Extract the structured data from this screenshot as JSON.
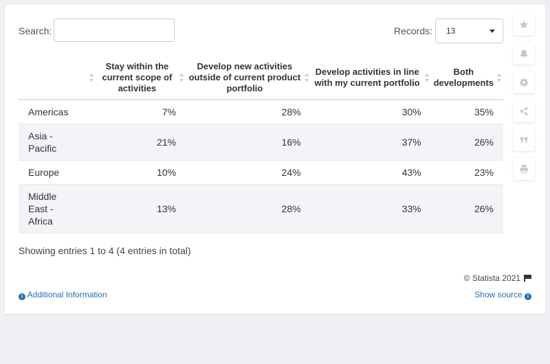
{
  "search": {
    "label": "Search:",
    "value": "",
    "placeholder": ""
  },
  "records": {
    "label": "Records:",
    "value": "13"
  },
  "table": {
    "columns": [
      "",
      "Stay within the current scope of activities",
      "Develop new activities outside of current product portfolio",
      "Develop activities in line with my current portfolio",
      "Both developments"
    ],
    "rows": [
      {
        "region": "Americas",
        "values": [
          "7%",
          "28%",
          "30%",
          "35%"
        ]
      },
      {
        "region": "Asia - Pacific",
        "values": [
          "21%",
          "16%",
          "37%",
          "26%"
        ]
      },
      {
        "region": "Europe",
        "values": [
          "10%",
          "24%",
          "43%",
          "23%"
        ]
      },
      {
        "region": "Middle East - Africa",
        "values": [
          "13%",
          "28%",
          "33%",
          "26%"
        ]
      }
    ]
  },
  "footer": {
    "showing": "Showing entries 1 to 4 (4 entries in total)",
    "copyright": "© Statista 2021",
    "additional_info": "Additional Information",
    "show_source": "Show source"
  },
  "toolbar": [
    "star-icon",
    "bell-icon",
    "gear-icon",
    "share-icon",
    "quote-icon",
    "print-icon"
  ],
  "colors": {
    "link": "#1f6fb5",
    "row_alt": "#f2f4f7",
    "icon": "#c4c9d0"
  }
}
